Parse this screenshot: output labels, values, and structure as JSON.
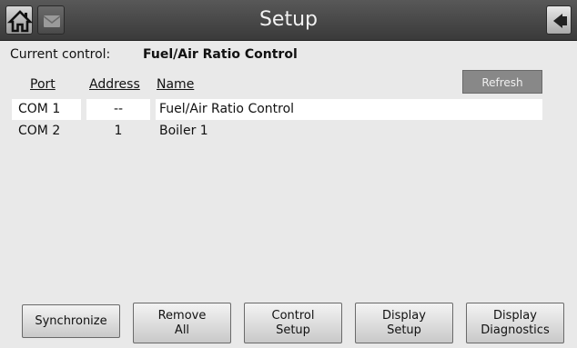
{
  "header": {
    "title": "Setup"
  },
  "current_control": {
    "label": "Current control:",
    "value": "Fuel/Air Ratio Control"
  },
  "table": {
    "headers": [
      "Port",
      "Address",
      "Name"
    ],
    "rows": [
      {
        "port": "COM 1",
        "address": "--",
        "name": "Fuel/Air Ratio Control",
        "selected": true
      },
      {
        "port": "COM 2",
        "address": "1",
        "name": "Boiler 1",
        "selected": false
      }
    ]
  },
  "refresh_label": "Refresh",
  "bottom_buttons": {
    "synchronize": "Synchronize",
    "remove_all": "Remove\nAll",
    "control_setup": "Control\nSetup",
    "display_setup": "Display\nSetup",
    "display_diagnostics": "Display\nDiagnostics"
  },
  "icons": {
    "home": "home-icon",
    "message": "message-icon",
    "back": "back-arrow-icon"
  },
  "colors": {
    "topbar": "#4a4a4a",
    "background": "#e9e9e9",
    "refresh": "#888888",
    "selected_row": "#ffffff"
  }
}
